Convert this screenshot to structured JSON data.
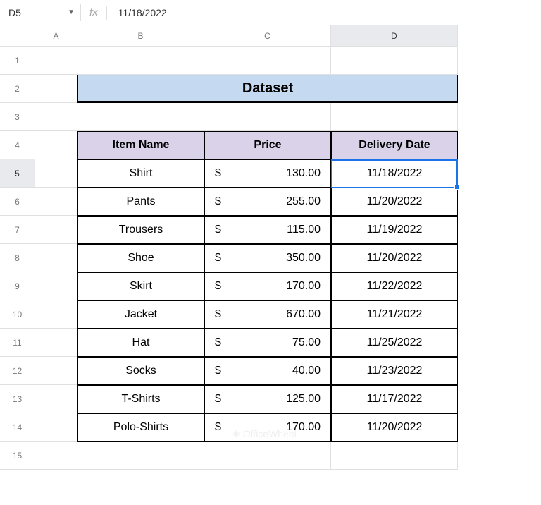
{
  "formula_bar": {
    "cell_ref": "D5",
    "formula_value": "11/18/2022",
    "fx_label": "fx"
  },
  "columns": [
    "A",
    "B",
    "C",
    "D"
  ],
  "selected_column": "D",
  "rows": [
    "1",
    "2",
    "3",
    "4",
    "5",
    "6",
    "7",
    "8",
    "9",
    "10",
    "11",
    "12",
    "13",
    "14",
    "15"
  ],
  "selected_row": "5",
  "title": "Dataset",
  "headers": {
    "item": "Item Name",
    "price": "Price",
    "delivery": "Delivery Date"
  },
  "data": [
    {
      "item": "Shirt",
      "currency": "$",
      "price": "130.00",
      "delivery": "11/18/2022"
    },
    {
      "item": "Pants",
      "currency": "$",
      "price": "255.00",
      "delivery": "11/20/2022"
    },
    {
      "item": "Trousers",
      "currency": "$",
      "price": "115.00",
      "delivery": "11/19/2022"
    },
    {
      "item": "Shoe",
      "currency": "$",
      "price": "350.00",
      "delivery": "11/20/2022"
    },
    {
      "item": "Skirt",
      "currency": "$",
      "price": "170.00",
      "delivery": "11/22/2022"
    },
    {
      "item": "Jacket",
      "currency": "$",
      "price": "670.00",
      "delivery": "11/21/2022"
    },
    {
      "item": "Hat",
      "currency": "$",
      "price": "75.00",
      "delivery": "11/25/2022"
    },
    {
      "item": "Socks",
      "currency": "$",
      "price": "40.00",
      "delivery": "11/23/2022"
    },
    {
      "item": "T-Shirts",
      "currency": "$",
      "price": "125.00",
      "delivery": "11/17/2022"
    },
    {
      "item": "Polo-Shirts",
      "currency": "$",
      "price": "170.00",
      "delivery": "11/20/2022"
    }
  ],
  "watermark": "OfficeWheel",
  "chart_data": {
    "type": "table",
    "title": "Dataset",
    "columns": [
      "Item Name",
      "Price",
      "Delivery Date"
    ],
    "rows": [
      [
        "Shirt",
        130.0,
        "11/18/2022"
      ],
      [
        "Pants",
        255.0,
        "11/20/2022"
      ],
      [
        "Trousers",
        115.0,
        "11/19/2022"
      ],
      [
        "Shoe",
        350.0,
        "11/20/2022"
      ],
      [
        "Skirt",
        170.0,
        "11/22/2022"
      ],
      [
        "Jacket",
        670.0,
        "11/21/2022"
      ],
      [
        "Hat",
        75.0,
        "11/25/2022"
      ],
      [
        "Socks",
        40.0,
        "11/23/2022"
      ],
      [
        "T-Shirts",
        125.0,
        "11/17/2022"
      ],
      [
        "Polo-Shirts",
        170.0,
        "11/20/2022"
      ]
    ]
  }
}
